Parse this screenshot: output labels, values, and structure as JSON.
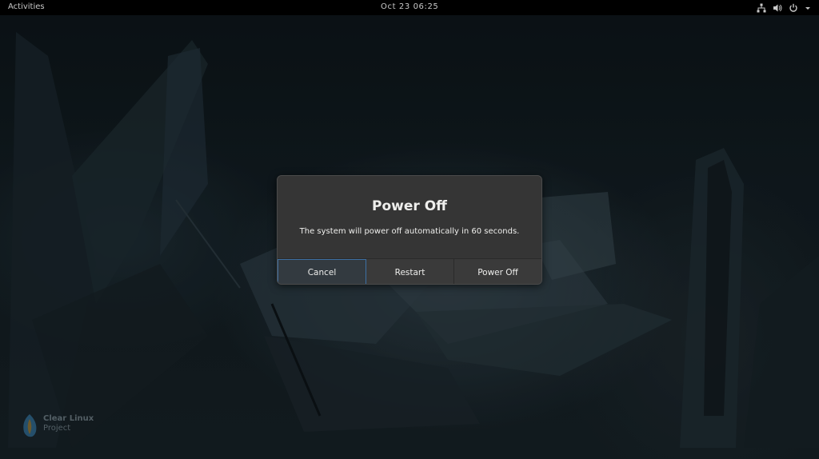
{
  "top_bar": {
    "activities_label": "Activities",
    "clock": "Oct 23  06:25",
    "tray_icons": [
      "network-icon",
      "volume-icon",
      "power-icon",
      "chevron-down-icon"
    ]
  },
  "wallpaper": {
    "logo_line1": "Clear Linux",
    "logo_line2": "Project"
  },
  "dialog": {
    "title": "Power Off",
    "message": "The system will power off automatically in 60 seconds.",
    "buttons": [
      {
        "label": "Cancel",
        "focused": true
      },
      {
        "label": "Restart",
        "focused": false
      },
      {
        "label": "Power Off",
        "focused": false
      }
    ]
  },
  "colors": {
    "accent_focus": "#3d6fa3",
    "dialog_bg": "#353535",
    "top_bar_bg": "#000000"
  }
}
